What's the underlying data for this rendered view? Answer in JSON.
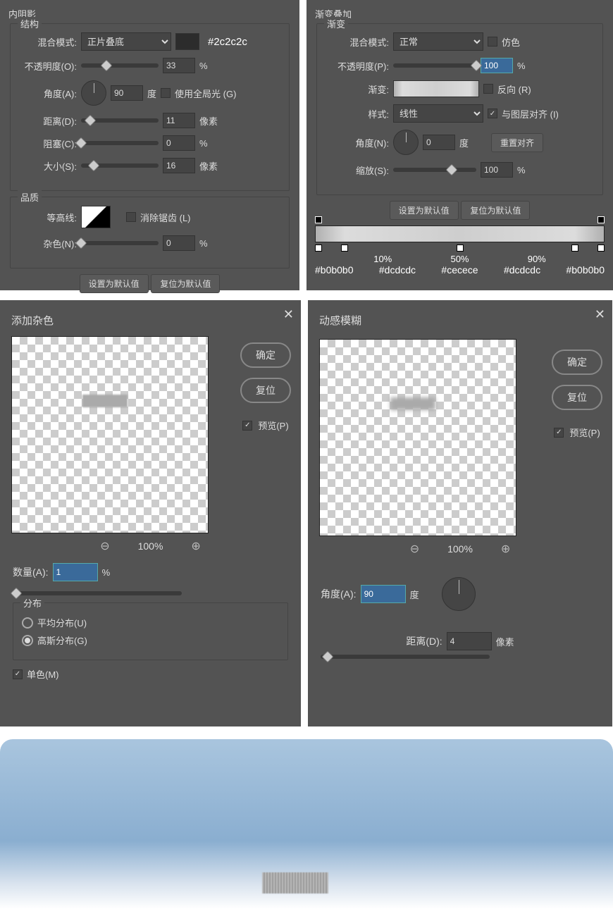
{
  "innerShadow": {
    "title": "内阴影",
    "structure": {
      "label": "结构",
      "blendModeLabel": "混合模式:",
      "blendMode": "正片叠底",
      "swatchHex": "#2c2c2c",
      "opacityLabel": "不透明度(O):",
      "opacity": "33",
      "opacityUnit": "%",
      "angleLabel": "角度(A):",
      "angle": "90",
      "angleUnit": "度",
      "useGlobalLabel": "使用全局光 (G)",
      "distanceLabel": "距离(D):",
      "distance": "11",
      "distanceUnit": "像素",
      "chokeLabel": "阻塞(C):",
      "choke": "0",
      "chokeUnit": "%",
      "sizeLabel": "大小(S):",
      "size": "16",
      "sizeUnit": "像素"
    },
    "quality": {
      "label": "品质",
      "contourLabel": "等高线:",
      "antiAliasLabel": "消除锯齿 (L)",
      "noiseLabel": "杂色(N):",
      "noise": "0",
      "noiseUnit": "%"
    },
    "setDefault": "设置为默认值",
    "resetDefault": "复位为默认值"
  },
  "gradientOverlay": {
    "title": "渐变叠加",
    "gradient": {
      "label": "渐变",
      "blendModeLabel": "混合模式:",
      "blendMode": "正常",
      "ditherLabel": "仿色",
      "opacityLabel": "不透明度(P):",
      "opacity": "100",
      "opacityUnit": "%",
      "gradientLabel": "渐变:",
      "reverseLabel": "反向 (R)",
      "styleLabel": "样式:",
      "style": "线性",
      "alignLabel": "与图层对齐 (I)",
      "angleLabel": "角度(N):",
      "angle": "0",
      "angleUnit": "度",
      "resetAlign": "重置对齐",
      "scaleLabel": "缩放(S):",
      "scale": "100",
      "scaleUnit": "%"
    },
    "setDefault": "设置为默认值",
    "resetDefault": "复位为默认值",
    "stops": {
      "p0": "#b0b0b0",
      "p10": "10%",
      "h10": "#dcdcdc",
      "p50": "50%",
      "h50": "#cecece",
      "p90": "90%",
      "h90": "#dcdcdc",
      "p100": "#b0b0b0"
    }
  },
  "addNoise": {
    "title": "添加杂色",
    "ok": "确定",
    "cancel": "复位",
    "previewLabel": "预览(P)",
    "zoom": "100%",
    "amountLabel": "数量(A):",
    "amount": "1",
    "amountUnit": "%",
    "distribution": {
      "label": "分布",
      "uniform": "平均分布(U)",
      "gaussian": "高斯分布(G)"
    },
    "monoLabel": "单色(M)"
  },
  "motionBlur": {
    "title": "动感模糊",
    "ok": "确定",
    "cancel": "复位",
    "previewLabel": "预览(P)",
    "zoom": "100%",
    "angleLabel": "角度(A):",
    "angle": "90",
    "angleUnit": "度",
    "distanceLabel": "距离(D):",
    "distance": "4",
    "distanceUnit": "像素"
  }
}
